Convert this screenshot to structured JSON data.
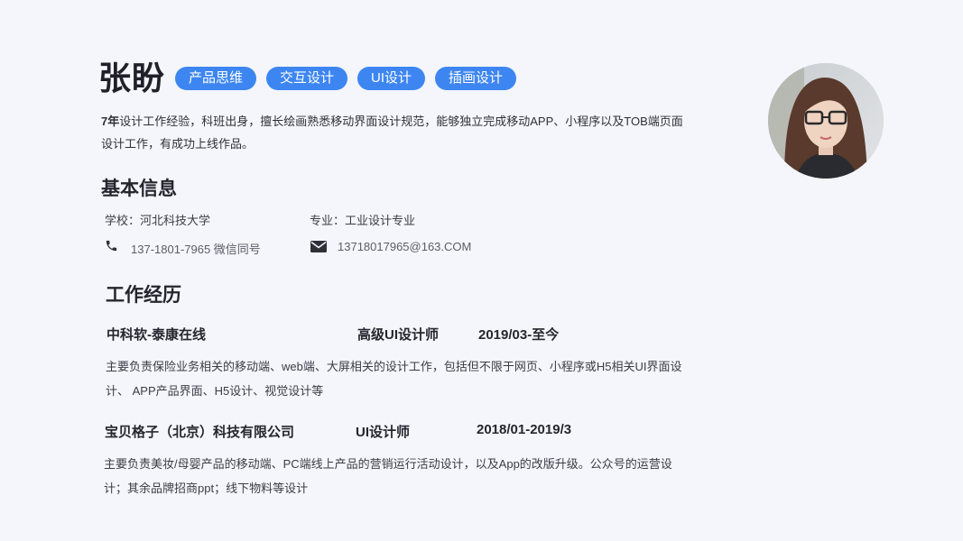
{
  "name": "张盼",
  "tags": [
    "产品思维",
    "交互设计",
    "UI设计",
    "插画设计"
  ],
  "summary": {
    "bold": "7年",
    "text": "设计工作经验，科班出身，擅长绘画熟悉移动界面设计规范，能够独立完成移动APP、小程序以及TOB端页面设计工作，有成功上线作品。"
  },
  "basic_info": {
    "title": "基本信息",
    "school": "学校：河北科技大学",
    "major": "专业：工业设计专业",
    "phone": "137-1801-7965 微信同号",
    "email": "13718017965@163.COM"
  },
  "work": {
    "title": "工作经历",
    "jobs": [
      {
        "company": "中科软-泰康在线",
        "role": "高级UI设计师",
        "period": "2019/03-至今",
        "desc": "主要负责保险业务相关的移动端、web端、大屏相关的设计工作，包括但不限于网页、小程序或H5相关UI界面设计、 APP产品界面、H5设计、视觉设计等"
      },
      {
        "company": "宝贝格子（北京）科技有限公司",
        "role": "UI设计师",
        "period": "2018/01-2019/3",
        "desc": "主要负责美妆/母婴产品的移动端、PC端线上产品的营销运行活动设计，以及App的改版升级。公众号的运营设计；其余品牌招商ppt；线下物料等设计"
      }
    ]
  },
  "colors": {
    "accent": "#3d86f2",
    "background": "#f4f6fb"
  },
  "icons": {
    "phone": "phone-icon",
    "email": "mail-icon"
  }
}
